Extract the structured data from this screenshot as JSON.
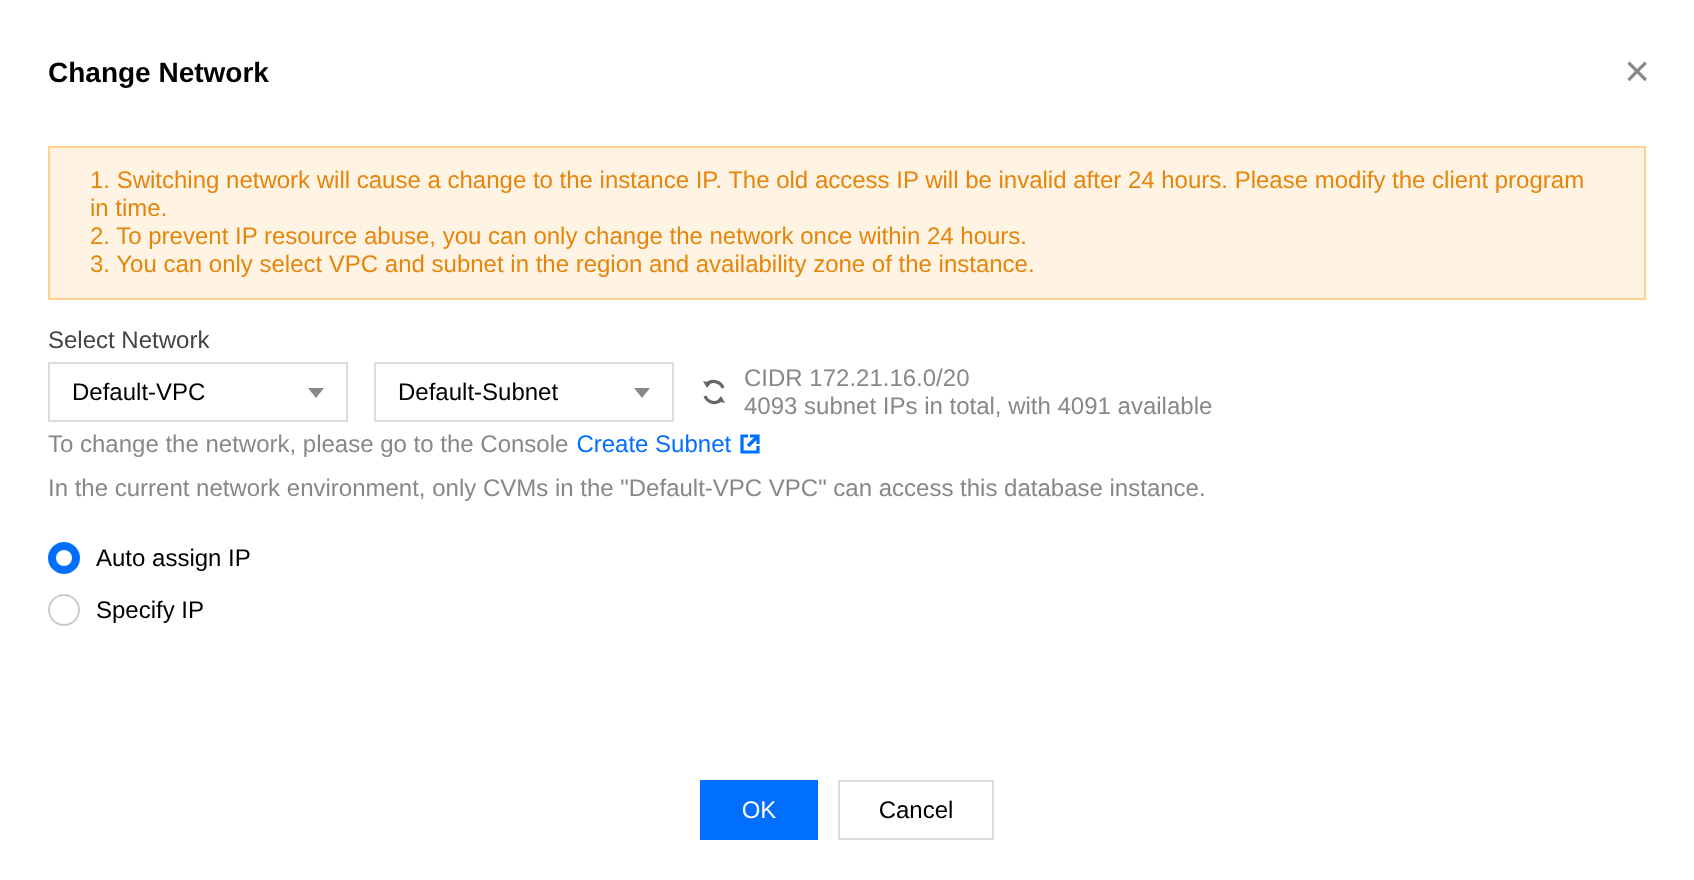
{
  "dialog": {
    "title": "Change Network",
    "close": "×"
  },
  "notice": [
    "1. Switching network will cause a change to the instance IP. The old access IP will be invalid after 24 hours. Please modify the client program in time.",
    "2. To prevent IP resource abuse, you can only change the network once within 24 hours.",
    "3. You can only select VPC and subnet in the region and availability zone of the instance."
  ],
  "network": {
    "label": "Select Network",
    "vpc": "Default-VPC",
    "subnet": "Default-Subnet",
    "cidr": "CIDR 172.21.16.0/20",
    "ip_info": "4093 subnet IPs in total, with 4091 available"
  },
  "help": {
    "text": "To change the network, please go to the Console",
    "link": "Create Subnet"
  },
  "access_note": "In the current network environment, only CVMs in the \"Default-VPC VPC\" can access this database instance.",
  "ip_options": [
    {
      "label": "Auto assign IP",
      "selected": true
    },
    {
      "label": "Specify IP",
      "selected": false
    }
  ],
  "buttons": [
    {
      "label": "OK",
      "kind": "primary"
    },
    {
      "label": "Cancel",
      "kind": "secondary"
    }
  ]
}
